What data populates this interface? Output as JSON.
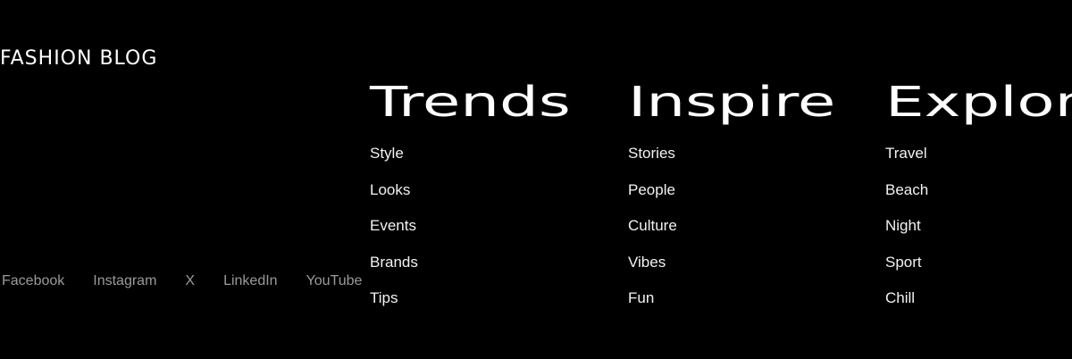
{
  "brand": {
    "title": "FASHION BLOG"
  },
  "columns": [
    {
      "heading": "Trends",
      "links": [
        "Style",
        "Looks",
        "Events",
        "Brands",
        "Tips"
      ]
    },
    {
      "heading": "Inspire",
      "links": [
        "Stories",
        "People",
        "Culture",
        "Vibes",
        "Fun"
      ]
    },
    {
      "heading": "Explore",
      "links": [
        "Travel",
        "Beach",
        "Night",
        "Sport",
        "Chill"
      ]
    }
  ],
  "social": {
    "links": [
      "Facebook",
      "Instagram",
      "X",
      "LinkedIn",
      "YouTube"
    ]
  },
  "colors": {
    "background": "#000000",
    "text": "#ffffff",
    "muted": "#9a9a9a"
  }
}
